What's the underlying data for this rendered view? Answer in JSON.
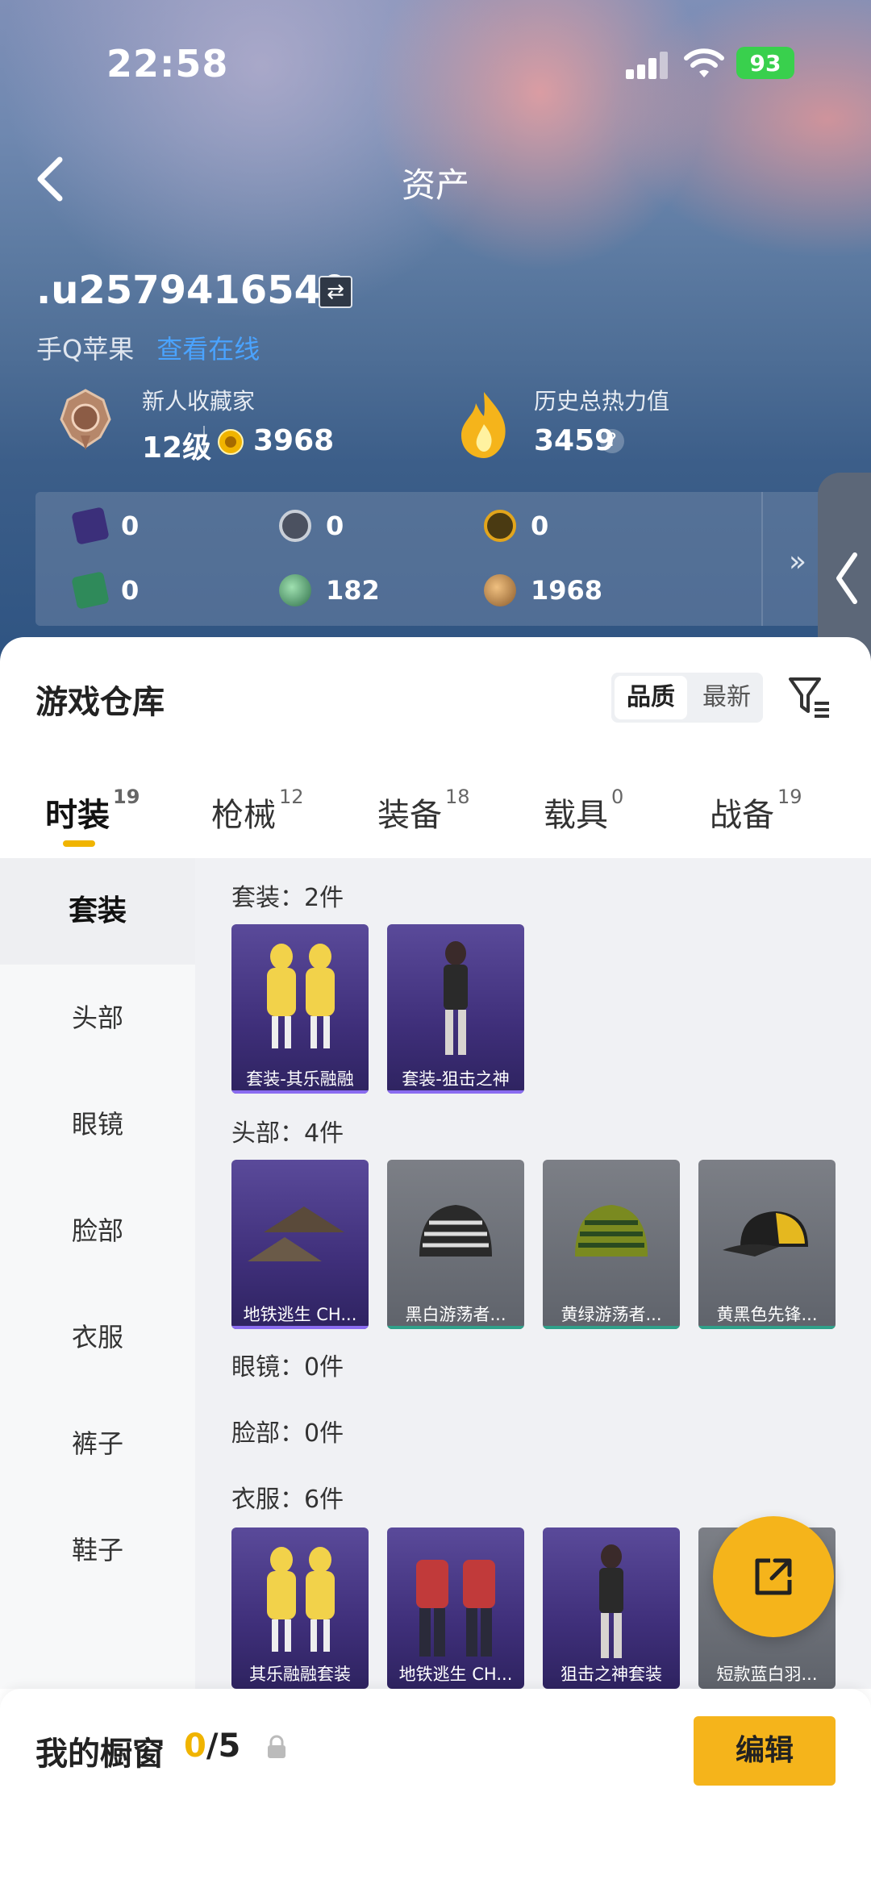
{
  "status": {
    "time": "22:58",
    "battery": "93"
  },
  "header": {
    "title": "资产"
  },
  "profile": {
    "username": ".u2579416540",
    "platform": "手Q苹果",
    "platform_link": "查看在线"
  },
  "stats": {
    "collector_label": "新人收藏家",
    "level": "12级",
    "points": "3968",
    "heat_label": "历史总热力值",
    "heat_value": "3459",
    "help": "?"
  },
  "currencies": [
    {
      "icon": "purple-card-icon",
      "value": "0"
    },
    {
      "icon": "silver-coin-icon",
      "value": "0"
    },
    {
      "icon": "gold-coin-icon",
      "value": "0"
    },
    {
      "icon": "green-card-icon",
      "value": "0"
    },
    {
      "icon": "green-gem-icon",
      "value": "182"
    },
    {
      "icon": "bronze-coin-icon",
      "value": "1968"
    }
  ],
  "warehouse": {
    "title": "游戏仓库",
    "sort_quality": "品质",
    "sort_newest": "最新"
  },
  "tabs": [
    {
      "label": "时装",
      "count": "19"
    },
    {
      "label": "枪械",
      "count": "12"
    },
    {
      "label": "装备",
      "count": "18"
    },
    {
      "label": "载具",
      "count": "0"
    },
    {
      "label": "战备",
      "count": "19"
    }
  ],
  "sidenav": [
    "套装",
    "头部",
    "眼镜",
    "脸部",
    "衣服",
    "裤子",
    "鞋子"
  ],
  "sections": {
    "suits": "套装：2件",
    "head": "头部：4件",
    "glasses": "眼镜：0件",
    "face": "脸部：0件",
    "clothes": "衣服：6件"
  },
  "cards": {
    "suit1": "套装-其乐融融",
    "suit2": "套装-狙击之神",
    "head1": "地铁逃生 CH...",
    "head2": "黑白游荡者...",
    "head3": "黄绿游荡者...",
    "head4": "黄黑色先锋...",
    "cloth1": "其乐融融套装",
    "cloth2": "地铁逃生 CH...",
    "cloth3": "狙击之神套装",
    "cloth4": "短款蓝白羽..."
  },
  "showcase": {
    "label": "我的橱窗",
    "current": "0",
    "total": "/5",
    "edit": "编辑"
  },
  "colors": {
    "accent": "#f5b41b",
    "card_purple": "#3f2f7a",
    "card_grey": "#5f636b"
  }
}
